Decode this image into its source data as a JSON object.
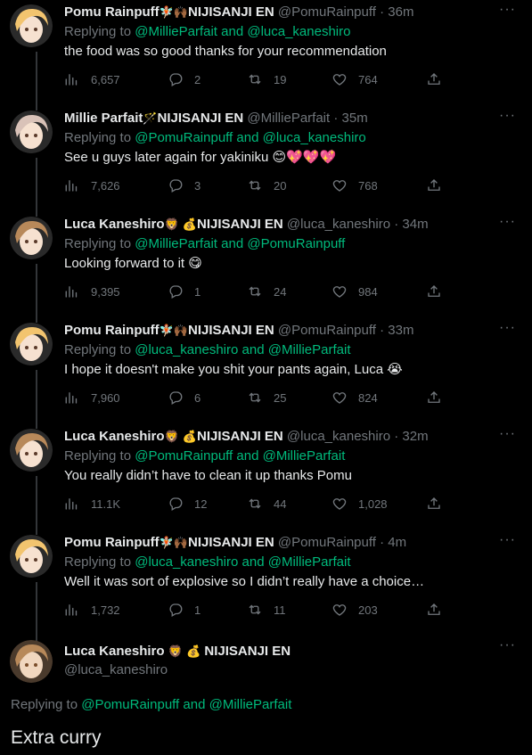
{
  "colors": {
    "background": "#000000",
    "text": "#e7e9ea",
    "muted": "#71767b",
    "mention": "#00ba7c",
    "thread_line": "#333639"
  },
  "icons": {
    "views": "bar-chart-icon",
    "reply": "speech-bubble-icon",
    "retweet": "retweet-arrows-icon",
    "like": "heart-icon",
    "share": "share-upload-icon",
    "more": "ellipsis-icon"
  },
  "tweets": [
    {
      "name": "Pomu Rainpuff",
      "emoji": "🧚🏼🙌🏾",
      "org": "NIJISANJI EN",
      "handle": "@PomuRainpuff",
      "time": "36m",
      "replying_prefix": "Replying to ",
      "mention1": "@MillieParfait",
      "and": " and ",
      "mention2": "@luca_kaneshiro",
      "text": "the food was so good thanks for your recommendation",
      "views": "6,657",
      "replies": "2",
      "retweets": "19",
      "likes": "764",
      "avatar_color": "#f2c46f"
    },
    {
      "name": "Millie Parfait",
      "emoji": "🪄",
      "org": "NIJISANJI EN",
      "handle": "@MillieParfait",
      "time": "35m",
      "replying_prefix": "Replying to ",
      "mention1": "@PomuRainpuff",
      "and": " and ",
      "mention2": "@luca_kaneshiro",
      "text": "See u guys later again for yakiniku 😊💖💖💖",
      "views": "7,626",
      "replies": "3",
      "retweets": "20",
      "likes": "768",
      "avatar_color": "#d9c2b8"
    },
    {
      "name": "Luca Kaneshiro",
      "emoji": "🦁 💰",
      "org": "NIJISANJI EN",
      "handle": "@luca_kaneshiro",
      "time": "34m",
      "replying_prefix": "Replying to ",
      "mention1": "@MillieParfait",
      "and": " and ",
      "mention2": "@PomuRainpuff",
      "text": "Looking forward to it 😋",
      "views": "9,395",
      "replies": "1",
      "retweets": "24",
      "likes": "984",
      "avatar_color": "#b8895a"
    },
    {
      "name": "Pomu Rainpuff",
      "emoji": "🧚🏼🙌🏾",
      "org": "NIJISANJI EN",
      "handle": "@PomuRainpuff",
      "time": "33m",
      "replying_prefix": "Replying to ",
      "mention1": "@luca_kaneshiro",
      "and": " and ",
      "mention2": "@MillieParfait",
      "text": "I hope it doesn't make you shit your pants again, Luca 😭",
      "views": "7,960",
      "replies": "6",
      "retweets": "25",
      "likes": "824",
      "avatar_color": "#f2c46f"
    },
    {
      "name": "Luca Kaneshiro",
      "emoji": "🦁 💰",
      "org": "NIJISANJI EN",
      "handle": "@luca_kaneshiro",
      "time": "32m",
      "replying_prefix": "Replying to ",
      "mention1": "@PomuRainpuff",
      "and": " and ",
      "mention2": "@MillieParfait",
      "text": "You really didn’t have to clean it up thanks Pomu",
      "views": "11.1K",
      "replies": "12",
      "retweets": "44",
      "likes": "1,028",
      "avatar_color": "#b8895a"
    },
    {
      "name": "Pomu Rainpuff",
      "emoji": "🧚🏼🙌🏾",
      "org": "NIJISANJI EN",
      "handle": "@PomuRainpuff",
      "time": "4m",
      "replying_prefix": "Replying to ",
      "mention1": "@luca_kaneshiro",
      "and": " and ",
      "mention2": "@MillieParfait",
      "text": "Well it was sort of explosive so I didn’t really have a choice…",
      "views": "1,732",
      "replies": "1",
      "retweets": "11",
      "likes": "203",
      "avatar_color": "#f2c46f"
    }
  ],
  "main_tweet": {
    "name": "Luca Kaneshiro",
    "emoji": "🦁 💰",
    "org": "NIJISANJI EN",
    "handle": "@luca_kaneshiro",
    "replying_prefix": "Replying to ",
    "mention1": "@PomuRainpuff",
    "and": " and ",
    "mention2": "@MillieParfait",
    "text": "Extra curry"
  },
  "dot": " · "
}
